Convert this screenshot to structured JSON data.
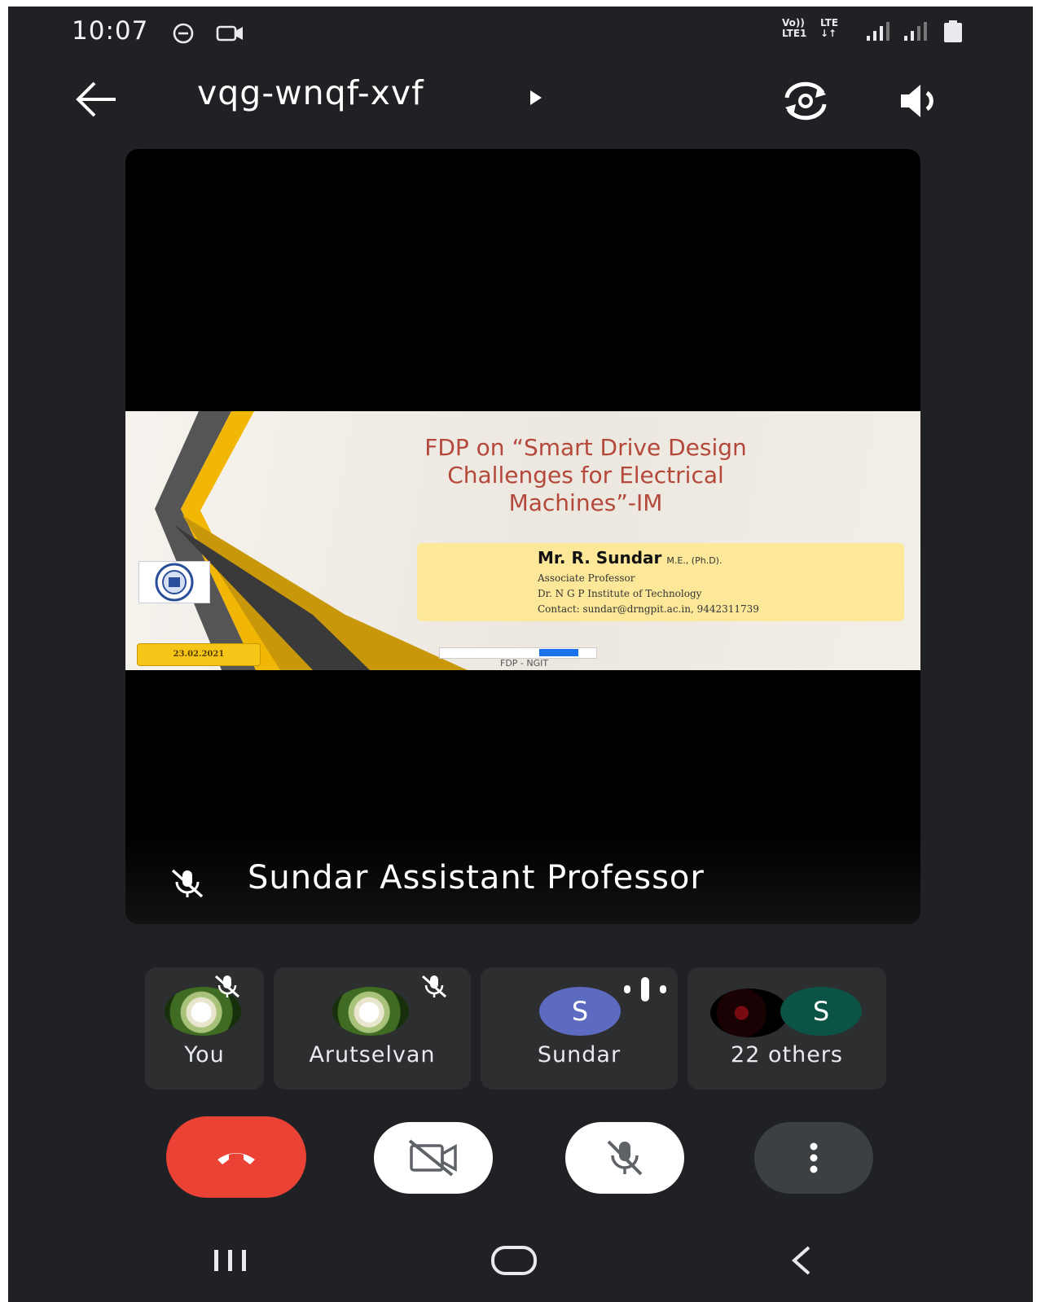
{
  "status_bar": {
    "time": "10:07",
    "network_label_top": "Vo))",
    "network_label_bottom": "LTE1",
    "lte_top": "LTE",
    "lte_bottom": "↓↑"
  },
  "app_bar": {
    "meeting_code": "vqg-wnqf-xvf"
  },
  "main_tile": {
    "speaker_label": "Sundar Assistant Professor",
    "slide": {
      "title_line1": "FDP on “Smart Drive Design",
      "title_line2": "Challenges for Electrical",
      "title_line3": "Machines”-IM",
      "presenter_name": "Mr. R. Sundar",
      "presenter_degree": "M.E., (Ph.D).",
      "presenter_role": "Associate Professor",
      "presenter_institute": "Dr. N G P Institute of Technology",
      "presenter_contact": "Contact: sundar@drngpit.ac.in, 9442311739",
      "date": "23.02.2021",
      "footer": "FDP - NGIT"
    }
  },
  "participants": [
    {
      "name": "You"
    },
    {
      "name": "Arutselvan"
    },
    {
      "name": "Sundar",
      "initial": "S"
    },
    {
      "name": "22 others",
      "initial": "S"
    }
  ],
  "colors": {
    "background": "#202124",
    "tile": "#2d2e30",
    "end_call": "#ea4335",
    "avatar_sundar": "#5c6bc0",
    "avatar_others": "#0b5345",
    "slide_title": "#b4483a"
  }
}
